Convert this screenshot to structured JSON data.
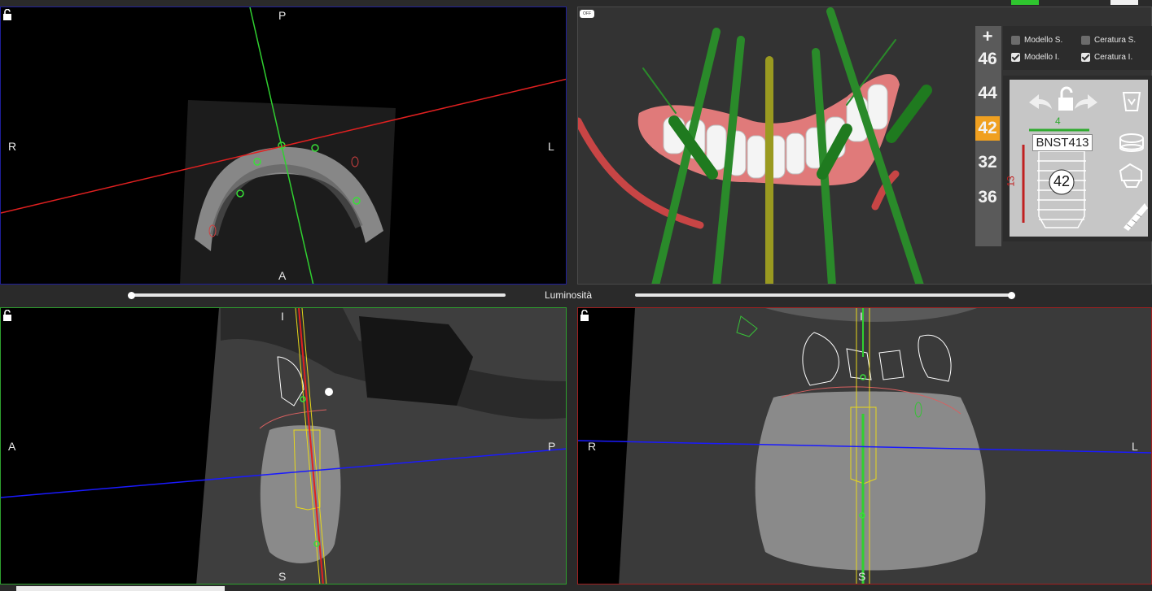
{
  "views": {
    "axial": {
      "top": "P",
      "bottom": "A",
      "left": "R",
      "right": "L"
    },
    "sagittal": {
      "top": "I",
      "bottom": "S",
      "left": "A",
      "right": "P"
    },
    "coronal": {
      "top": "I",
      "bottom": "S",
      "left": "R",
      "right": "L"
    },
    "render3d": {
      "off_badge": "OFF"
    }
  },
  "brightness_label": "Luminosità",
  "tooth_list": {
    "add_label": "+",
    "items": [
      "46",
      "44",
      "42",
      "32",
      "36"
    ],
    "selected": "42"
  },
  "layers": [
    {
      "label": "Modello S.",
      "checked": false
    },
    {
      "label": "Ceratura S.",
      "checked": false
    },
    {
      "label": "Modello I.",
      "checked": true
    },
    {
      "label": "Ceratura I.",
      "checked": true
    }
  ],
  "implant": {
    "code": "BNST413",
    "tooth": "42",
    "diameter": "4",
    "length": "13"
  },
  "icons": [
    "lock-icon",
    "undo-icon",
    "unlock-icon",
    "redo-icon",
    "trash-icon",
    "abutment-icon",
    "crown-icon",
    "screw-icon"
  ],
  "colors": {
    "selected_tab": "#f0a020",
    "red_axis": "#e02020",
    "green_axis": "#30d030",
    "blue_axis": "#1a1aff"
  }
}
